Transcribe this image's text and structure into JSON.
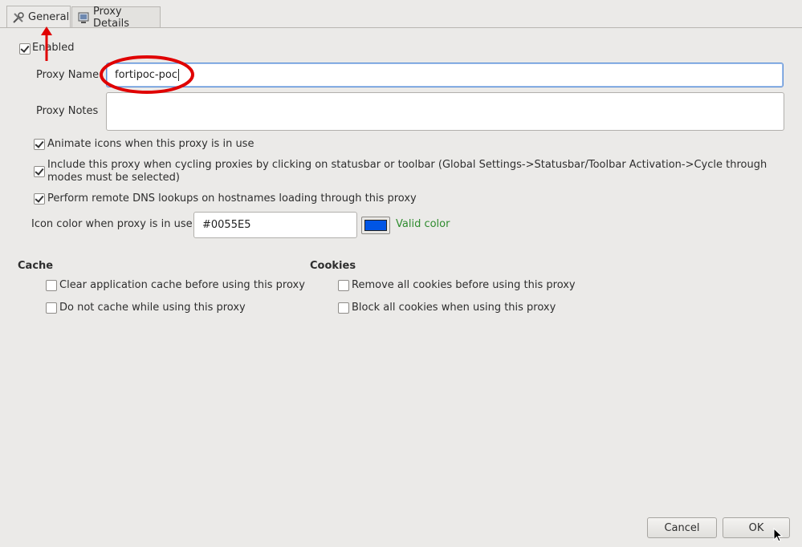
{
  "tabs": [
    {
      "label": "General",
      "mnemonic": "G",
      "icon": "tools-icon",
      "active": true
    },
    {
      "label": "Proxy Details",
      "mnemonic": "P",
      "icon": "monitor-icon",
      "active": false
    }
  ],
  "enabled": {
    "label": "Enabled",
    "checked": true
  },
  "proxy_name": {
    "label": "Proxy Name",
    "value": "fortipoc-poc"
  },
  "proxy_notes": {
    "label": "Proxy Notes",
    "value": ""
  },
  "options": [
    {
      "label": "Animate icons when this proxy is in use",
      "checked": true
    },
    {
      "label": "Include this proxy when cycling proxies by clicking on statusbar or toolbar (Global Settings->Statusbar/Toolbar Activation->Cycle through modes must be selected)",
      "checked": true
    },
    {
      "label": "Perform remote DNS lookups on hostnames loading through this proxy",
      "checked": true
    }
  ],
  "icon_color": {
    "label": "Icon color when proxy is in use",
    "value": "#0055E5",
    "swatch": "#0055E5",
    "status": "Valid color",
    "status_color": "#2e8b2e"
  },
  "cache": {
    "title": "Cache",
    "items": [
      {
        "label": "Clear application cache before using this proxy",
        "checked": false
      },
      {
        "label": "Do not cache while using this proxy",
        "checked": false
      }
    ]
  },
  "cookies": {
    "title": "Cookies",
    "items": [
      {
        "label": "Remove all cookies before using this proxy",
        "checked": false
      },
      {
        "label": "Block all cookies when using this proxy",
        "checked": false
      }
    ]
  },
  "buttons": {
    "cancel": "Cancel",
    "ok": "OK"
  },
  "annotations": {
    "color": "#e00000"
  }
}
